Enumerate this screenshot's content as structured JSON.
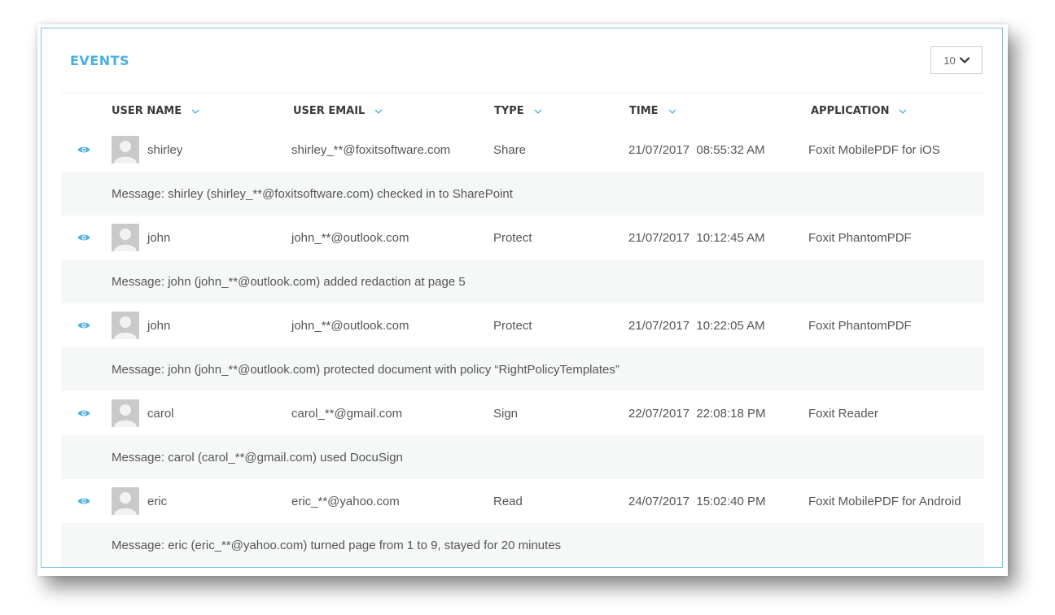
{
  "panel": {
    "title": "EVENTS",
    "page_size": "10"
  },
  "columns": [
    {
      "label": "USER NAME"
    },
    {
      "label": "USER EMAIL"
    },
    {
      "label": "TYPE"
    },
    {
      "label": "TIME"
    },
    {
      "label": "APPLICATION"
    }
  ],
  "events": [
    {
      "name": "shirley",
      "email": "shirley_**@foxitsoftware.com",
      "type": "Share",
      "time": "21/07/2017  08:55:32 AM",
      "application": "Foxit MobilePDF for iOS",
      "message": "Message: shirley (shirley_**@foxitsoftware.com) checked in to SharePoint"
    },
    {
      "name": "john",
      "email": "john_**@outlook.com",
      "type": "Protect",
      "time": "21/07/2017  10:12:45 AM",
      "application": "Foxit PhantomPDF",
      "message": "Message: john (john_**@outlook.com) added redaction at page 5"
    },
    {
      "name": "john",
      "email": "john_**@outlook.com",
      "type": "Protect",
      "time": "21/07/2017  10:22:05 AM",
      "application": "Foxit PhantomPDF",
      "message": "Message: john (john_**@outlook.com) protected document with policy “RightPolicyTemplates”"
    },
    {
      "name": "carol",
      "email": "carol_**@gmail.com",
      "type": "Sign",
      "time": "22/07/2017  22:08:18 PM",
      "application": "Foxit Reader",
      "message": "Message: carol (carol_**@gmail.com) used DocuSign"
    },
    {
      "name": "eric",
      "email": "eric_**@yahoo.com",
      "type": "Read",
      "time": "24/07/2017  15:02:40 PM",
      "application": "Foxit MobilePDF for Android",
      "message": "Message: eric (eric_**@yahoo.com) turned page from 1 to 9, stayed for 20 minutes"
    }
  ],
  "colors": {
    "accent": "#4aaee4",
    "border": "#7cc4e2",
    "message_bg": "#f6f8f8"
  },
  "icons": {
    "view": "eye-icon",
    "sort": "chevron-down-icon",
    "dropdown": "chevron-down-icon",
    "avatar": "user-placeholder-icon"
  }
}
